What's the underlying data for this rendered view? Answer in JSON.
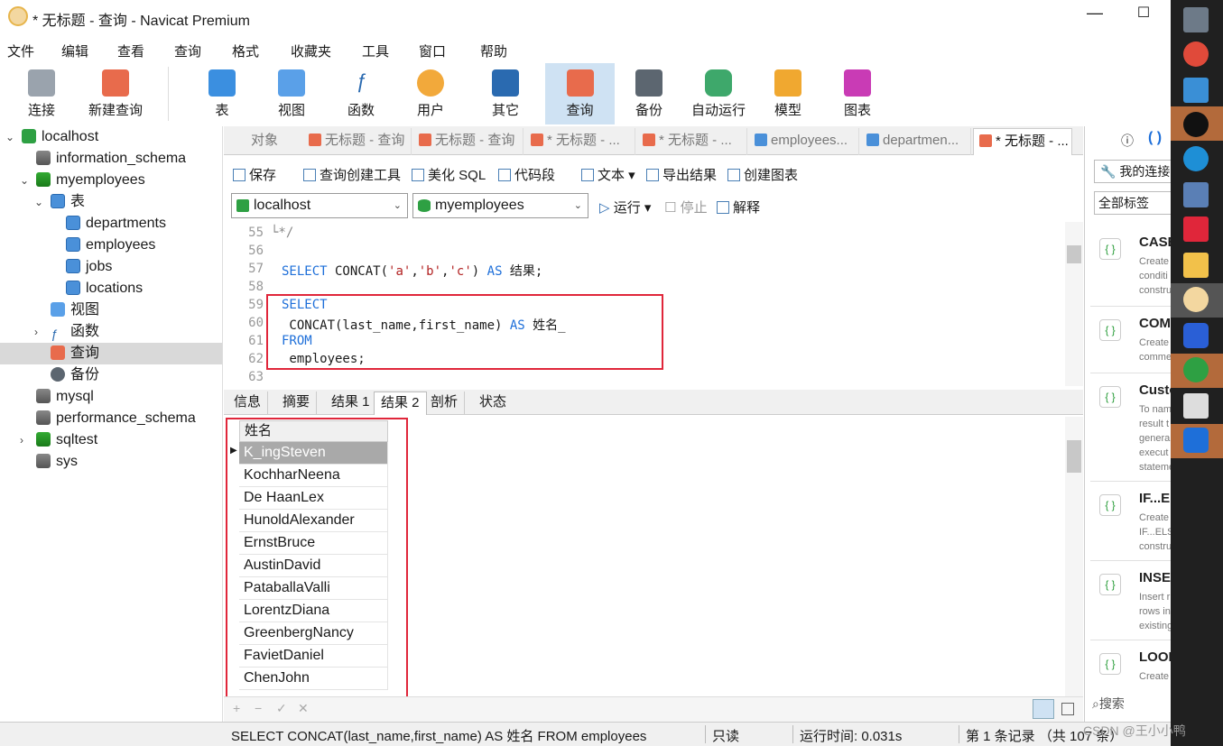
{
  "window": {
    "title": "* 无标题 - 查询 - Navicat Premium",
    "minimize": "—",
    "maximize": "☐"
  },
  "menu": [
    "文件",
    "编辑",
    "查看",
    "查询",
    "格式",
    "收藏夹",
    "工具",
    "窗口",
    "帮助"
  ],
  "toolbar": {
    "connect": "连接",
    "new_query": "新建查询",
    "table": "表",
    "view": "视图",
    "function": "函数",
    "user": "用户",
    "other": "其它",
    "query": "查询",
    "backup": "备份",
    "automation": "自动运行",
    "model": "模型",
    "chart": "图表"
  },
  "tree": {
    "localhost": "localhost",
    "information_schema": "information_schema",
    "myemployees": "myemployees",
    "tables": "表",
    "departments": "departments",
    "employees": "employees",
    "jobs": "jobs",
    "locations": "locations",
    "views": "视图",
    "functions": "函数",
    "queries": "查询",
    "backups": "备份",
    "mysql": "mysql",
    "performance_schema": "performance_schema",
    "sqltest": "sqltest",
    "sys": "sys"
  },
  "tabs": {
    "objects": "对象",
    "t1": "无标题 - 查询",
    "t2": "无标题 - 查询",
    "t3": "* 无标题 - ...",
    "t4": "* 无标题 - ...",
    "t5": "employees...",
    "t6": "departmen...",
    "t7": "* 无标题 - ..."
  },
  "editor_toolbar": {
    "save": "保存",
    "query_builder": "查询创建工具",
    "beautify": "美化 SQL",
    "snippet": "代码段",
    "text": "文本",
    "export": "导出结果",
    "create_chart": "创建图表",
    "connection": "localhost",
    "database": "myemployees",
    "run": "运行",
    "stop": "停止",
    "explain": "解释"
  },
  "code": {
    "line_numbers": [
      "55",
      "56",
      "57",
      "58",
      "59",
      "60",
      "61",
      "62",
      "63"
    ],
    "l55": "└*/",
    "l57_kw1": "SELECT",
    "l57_fn": " CONCAT(",
    "l57_s1": "'a'",
    "l57_c1": ",",
    "l57_s2": "'b'",
    "l57_c2": ",",
    "l57_s3": "'c'",
    "l57_close": ") ",
    "l57_kw2": "AS",
    "l57_alias": " 结果;",
    "l59": "SELECT",
    "l60_a": " CONCAT(last_name,first_name) ",
    "l60_kw": "AS",
    "l60_b": " 姓名_",
    "l61": "FROM",
    "l62": " employees;"
  },
  "result_tabs": [
    "信息",
    "摘要",
    "结果 1",
    "结果 2",
    "剖析",
    "状态"
  ],
  "grid": {
    "column": "姓名",
    "rows": [
      "K_ingSteven",
      "KochharNeena",
      "De HaanLex",
      "HunoldAlexander",
      "ErnstBruce",
      "AustinDavid",
      "PataballaValli",
      "LorentzDiana",
      "GreenbergNancy",
      "FavietDaniel",
      "ChenJohn"
    ]
  },
  "grid_footer": [
    "+",
    "−",
    "✓",
    "✕"
  ],
  "status": {
    "sql": "SELECT  CONCAT(last_name,first_name) AS 姓名 FROM  employees",
    "readonly": "只读",
    "runtime": "运行时间: 0.031s",
    "records": "第 1 条记录 （共 107 条）"
  },
  "right_panel": {
    "my_connections": "我的连接",
    "all_tags": "全部标签",
    "search": "搜索",
    "cards": [
      {
        "title": "CASE",
        "desc": [
          "Create",
          "conditi",
          "constru"
        ]
      },
      {
        "title": "COM",
        "desc": [
          "Create",
          "comme"
        ]
      },
      {
        "title": "Custo",
        "desc": [
          "To nam",
          "result t",
          "genera",
          "execut",
          "stateme"
        ]
      },
      {
        "title": "IF...EL",
        "desc": [
          "Create",
          "IF...ELS",
          "constru"
        ]
      },
      {
        "title": "INSE",
        "desc": [
          "Insert r",
          "rows in",
          "existing"
        ]
      },
      {
        "title": "LOOI",
        "desc": [
          "Create"
        ]
      }
    ]
  },
  "watermark": "CSDN @王小小鸭",
  "colors": {
    "accent": "#1e6fd9",
    "highlight_box": "#e0263a",
    "selected_row": "#a9a9a9"
  }
}
